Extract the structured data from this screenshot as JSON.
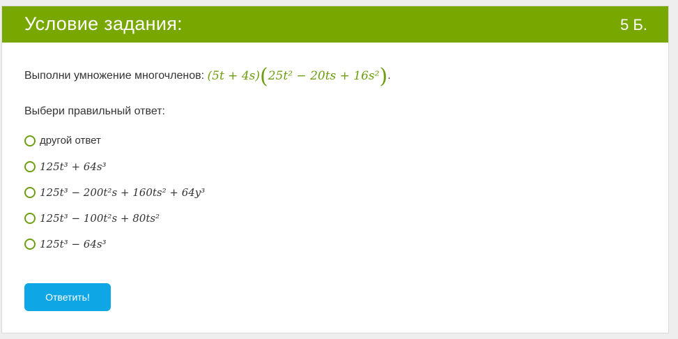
{
  "header": {
    "title": "Условие задания:",
    "points": "5 Б."
  },
  "task": {
    "prompt": "Выполни умножение многочленов:",
    "expr_left": "(5t + 4s)",
    "expr_right": "25t² − 20ts + 16s²",
    "end": "."
  },
  "choose_label": "Выбери правильный ответ:",
  "options": [
    {
      "text": "другой ответ"
    },
    {
      "text": "125t³ + 64s³"
    },
    {
      "text": "125t³ − 200t²s + 160ts² + 64y³"
    },
    {
      "text": "125t³ − 100t²s + 80ts²"
    },
    {
      "text": "125t³ − 64s³"
    }
  ],
  "submit_label": "Ответить!",
  "colors": {
    "header": "#78a800",
    "math": "#6d9d10",
    "button": "#0fa6e6"
  }
}
